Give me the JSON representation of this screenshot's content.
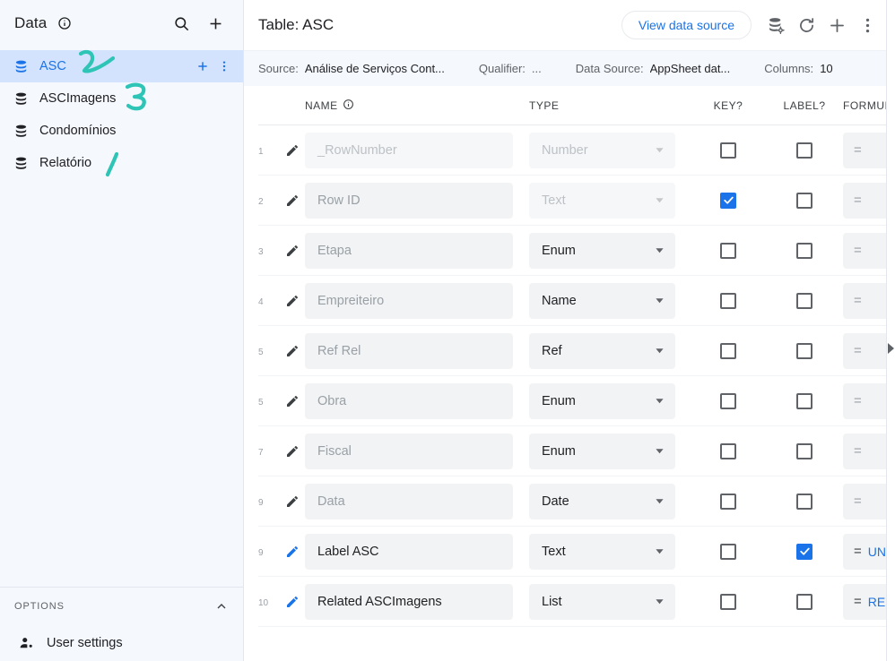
{
  "sidebar": {
    "header": {
      "title": "Data",
      "info_icon": "info-icon",
      "search_icon": "search-icon",
      "add_icon": "plus-icon"
    },
    "tables": [
      {
        "label": "ASC",
        "icon": "database-icon",
        "selected": true,
        "add_icon": "plus-icon",
        "more_icon": "more-vert-icon"
      },
      {
        "label": "ASCImagens",
        "icon": "database-icon",
        "selected": false
      },
      {
        "label": "Condomínios",
        "icon": "database-icon",
        "selected": false
      },
      {
        "label": "Relatório",
        "icon": "database-icon",
        "selected": false
      }
    ],
    "options": {
      "label": "OPTIONS",
      "collapse_icon": "chevron-up-icon",
      "items": [
        {
          "label": "User settings",
          "icon": "user-settings-icon"
        }
      ]
    },
    "annotations": [
      {
        "name": "ink-mark-2",
        "color": "#2ec4b6"
      },
      {
        "name": "ink-mark-3",
        "color": "#2ec4b6"
      },
      {
        "name": "ink-mark-stroke",
        "color": "#2ec4b6"
      }
    ]
  },
  "header": {
    "title": "Table: ASC",
    "view_data_source_label": "View data source",
    "icons": [
      {
        "name": "data-source-settings-icon"
      },
      {
        "name": "refresh-icon"
      },
      {
        "name": "plus-icon"
      },
      {
        "name": "more-vert-icon"
      }
    ]
  },
  "meta": {
    "source_key": "Source:",
    "source_value": "Análise de Serviços Cont...",
    "qualifier_key": "Qualifier:",
    "qualifier_value": "...",
    "datasource_key": "Data Source:",
    "datasource_value": "AppSheet dat...",
    "columns_key": "Columns:",
    "columns_value": "10"
  },
  "table": {
    "headers": {
      "num": "",
      "name": "NAME",
      "name_info_icon": "info-icon",
      "type": "TYPE",
      "key": "KEY?",
      "label": "LABEL?",
      "formula": "FORMUI"
    },
    "rows": [
      {
        "num": "1",
        "name": "_RowNumber",
        "name_state": "dimmer",
        "type": "Number",
        "type_state": "dim",
        "key": false,
        "label": false,
        "formula_eq": "=",
        "formula_text": ""
      },
      {
        "num": "2",
        "name": "Row ID",
        "name_state": "dim",
        "type": "Text",
        "type_state": "dim",
        "key": true,
        "label": false,
        "formula_eq": "=",
        "formula_text": ""
      },
      {
        "num": "3",
        "name": "Etapa",
        "name_state": "dim",
        "type": "Enum",
        "type_state": "dark",
        "key": false,
        "label": false,
        "formula_eq": "=",
        "formula_text": ""
      },
      {
        "num": "4",
        "name": "Empreiteiro",
        "name_state": "dim",
        "type": "Name",
        "type_state": "dark",
        "key": false,
        "label": false,
        "formula_eq": "=",
        "formula_text": ""
      },
      {
        "num": "5",
        "name": "Ref Rel",
        "name_state": "dim",
        "type": "Ref",
        "type_state": "dark",
        "key": false,
        "label": false,
        "formula_eq": "=",
        "formula_text": ""
      },
      {
        "num": "5",
        "name": "Obra",
        "name_state": "dim",
        "type": "Enum",
        "type_state": "dark",
        "key": false,
        "label": false,
        "formula_eq": "=",
        "formula_text": ""
      },
      {
        "num": "7",
        "name": "Fiscal",
        "name_state": "dim",
        "type": "Enum",
        "type_state": "dark",
        "key": false,
        "label": false,
        "formula_eq": "=",
        "formula_text": ""
      },
      {
        "num": "9",
        "name": "Data",
        "name_state": "dim",
        "type": "Date",
        "type_state": "dark",
        "key": false,
        "label": false,
        "formula_eq": "=",
        "formula_text": ""
      },
      {
        "num": "9",
        "name": "Label ASC",
        "name_state": "dark",
        "type": "Text",
        "type_state": "dark",
        "key": false,
        "label": true,
        "formula_eq": "=",
        "formula_text": "UN"
      },
      {
        "num": "10",
        "name": "Related ASCImagens",
        "name_state": "dark",
        "type": "List",
        "type_state": "dark",
        "key": false,
        "label": false,
        "formula_eq": "=",
        "formula_text": "RE"
      }
    ]
  },
  "right_panel": {
    "expand_icon": "triangle-right-icon"
  },
  "colors": {
    "accent": "#1a73e8",
    "selected_row_bg": "#d3e3fd",
    "sidebar_bg": "#f5f8fd",
    "field_bg": "#f1f3f4",
    "ink": "#2ec4b6"
  }
}
